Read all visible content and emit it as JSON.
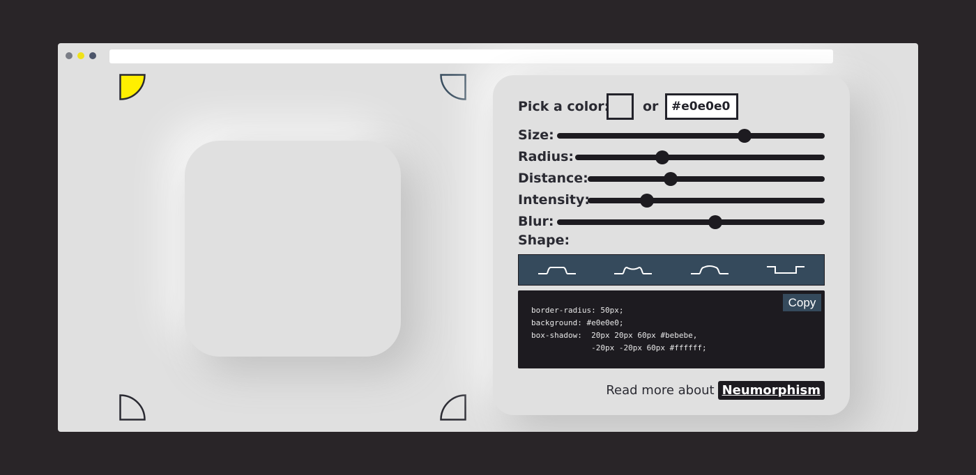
{
  "window": {
    "dots": [
      "close-dot",
      "minimize-dot",
      "maximize-dot"
    ]
  },
  "corners": {
    "active_color": "#ffef00",
    "inactive_color": "#2a2a32",
    "accent_color": "#354a5c"
  },
  "panel": {
    "pick_color_label": "Pick a color:",
    "or_label": "or",
    "hex_value": "#e0e0e0",
    "sliders": [
      {
        "label": "Size:",
        "value": 0.7
      },
      {
        "label": "Radius:",
        "value": 0.35
      },
      {
        "label": "Distance:",
        "value": 0.35
      },
      {
        "label": "Intensity:",
        "value": 0.25
      },
      {
        "label": "Blur:",
        "value": 0.59
      }
    ],
    "shape_label": "Shape:",
    "shapes": [
      {
        "name": "flat",
        "active": true
      },
      {
        "name": "concave",
        "active": false
      },
      {
        "name": "convex",
        "active": false
      },
      {
        "name": "pressed",
        "active": false
      }
    ],
    "code": "border-radius: 50px;\nbackground: #e0e0e0;\nbox-shadow:  20px 20px 60px #bebebe,\n             -20px -20px 60px #ffffff;",
    "copy_label": "Copy",
    "read_more_text": "Read more about",
    "read_more_link": "Neumorphism"
  }
}
